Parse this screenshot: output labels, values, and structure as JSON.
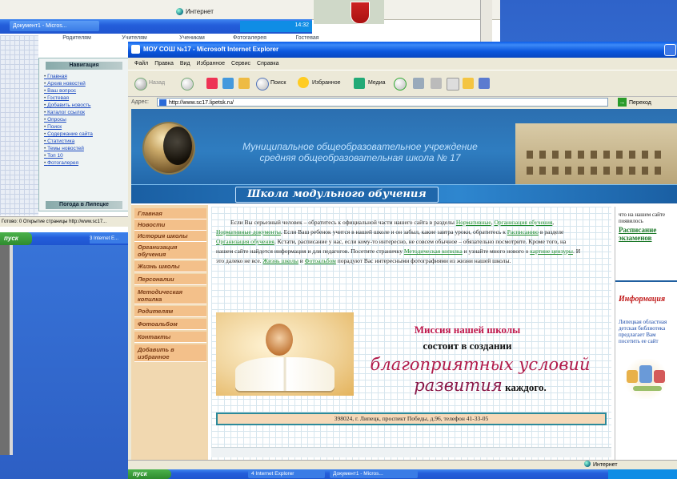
{
  "back_window": {
    "status_zone": "Интернет",
    "taskbar_button": "Документ1 - Micros...",
    "tabs": [
      "Родителям",
      "Учителям",
      "Ученикам",
      "Фотогалерея",
      "Гостевая"
    ],
    "nav_title": "Навигация",
    "nav_items": [
      "Главная",
      "Архив новостей",
      "Ваш вопрос",
      "Гостевая",
      "Добавить новость",
      "Каталог ссылок",
      "Опросы",
      "Поиск",
      "Содержание сайта",
      "Статистика",
      "Темы новостей",
      "Топ 10",
      "Фотогалерея"
    ],
    "nav_bottom": "Погода в Липецке",
    "status_text": "Готово: 0 Открытие страницы http://www.sc17...",
    "start_label": "пуск",
    "task2": "3 Internet E..."
  },
  "ie": {
    "title": "МОУ СОШ №17 - Microsoft Internet Explorer",
    "menu": [
      "Файл",
      "Правка",
      "Вид",
      "Избранное",
      "Сервис",
      "Справка"
    ],
    "toolbar": {
      "back": "Назад",
      "search": "Поиск",
      "favorites": "Избранное",
      "media": "Медиа"
    },
    "address_label": "Адрес:",
    "address_url": "http://www.sc17.lipetsk.ru/",
    "go_label": "Переход",
    "status_zone": "Интернет",
    "taskbar": {
      "start": "пуск",
      "tasks": [
        "4 Internet Explorer",
        "Документ1 - Micros..."
      ]
    }
  },
  "page": {
    "banner_line1": "Муниципальное общеобразовательное учреждение",
    "banner_line2": "средняя общеобразовательная школа № 17",
    "banner_school": "Школа модульного обучения",
    "nav": [
      "Главная",
      "Новости",
      "История школы",
      "Организация обучения",
      "Жизнь школы",
      "Персоналии",
      "Методическая копилка",
      "Родителям",
      "Фотоальбом",
      "Контакты",
      "Добавить в избранное"
    ],
    "intro": {
      "t1": "Если Вы серьезный человек – обратитесь к официальной части нашего сайта в разделы ",
      "l1": "Нормативные",
      "t2": ", ",
      "l2": "Организация обучения",
      "t3": ", ",
      "l3": "Нормативные документы",
      "t4": ". Если Ваш ребенок учится в нашей школе и он забыл, какие завтра уроки, обратитесь к ",
      "l4": "Расписанию",
      "t5": " в разделе ",
      "l5": "Организация обучения",
      "t6": ". Кстати, расписание у нас, если кому-то интересно, не совсем обычное – обязательно посмотрите. Кроме того, на нашем сайте найдется информация и для педагогов. Посетите страничку ",
      "l6": "Методическая копилка",
      "t7": " и узнайте много нового о ",
      "l7": "картине цензуры",
      "t8": ". И это далеко не все. ",
      "l8": "Жизнь школы",
      "t9": " и ",
      "l9": "Фотоальбом",
      "t10": " порадуют Вас интересными фотографиями из жизни нашей школы."
    },
    "mission_title": "Миссия нашей школы",
    "mission_2": "состоит в создании",
    "mission_3": "благоприятных условий",
    "mission_4a": "развития",
    "mission_4b": "каждого.",
    "address": "398024, г. Липецк, проспект Победы, д.96, телефон 41-33-05",
    "right": {
      "text1": "что на нашем сайте появилось",
      "link": "Расписание экзаменов",
      "info_title": "Информация",
      "text2": "Липецкая областная детская библиотека предлагает Вам посетить ее сайт"
    }
  }
}
